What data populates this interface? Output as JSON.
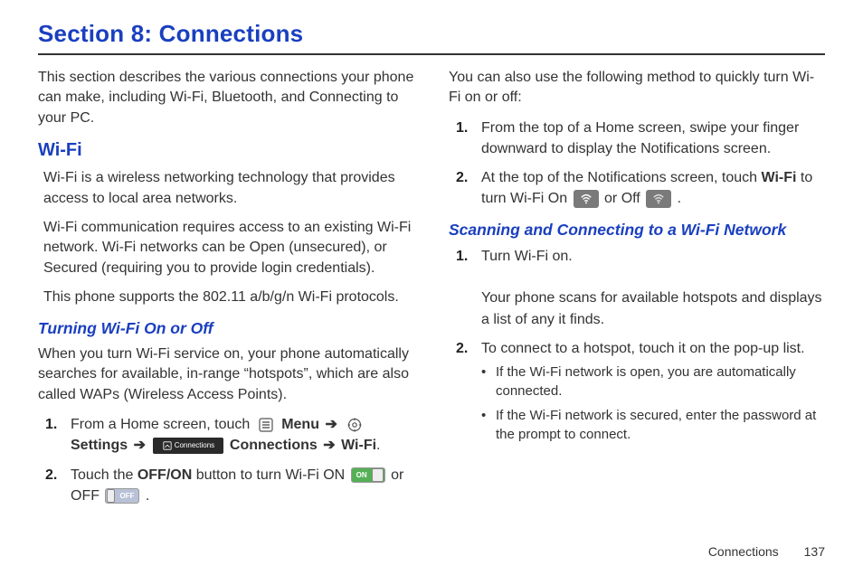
{
  "section_title": "Section 8: Connections",
  "footer": {
    "chapter": "Connections",
    "page": "137"
  },
  "left": {
    "intro": "This section describes the various connections your phone can make, including Wi-Fi, Bluetooth, and Connecting to your PC.",
    "wifi_heading": "Wi-Fi",
    "wifi_p1": "Wi-Fi is a wireless networking technology that provides access to local area networks.",
    "wifi_p2": "Wi-Fi communication requires access to an existing Wi-Fi network. Wi-Fi networks can be Open (unsecured), or Secured (requiring you to provide login credentials).",
    "wifi_p3": "This phone supports the 802.11 a/b/g/n Wi-Fi protocols.",
    "turning_heading": "Turning Wi-Fi On or Off",
    "turning_intro": "When you turn Wi-Fi service on, your phone automatically searches for available, in-range “hotspots”, which are also called WAPs (Wireless Access Points).",
    "step1": {
      "pre": "From a Home screen, touch ",
      "menu": "Menu",
      "settings": "Settings",
      "connections": "Connections",
      "wifi": "Wi-Fi",
      "arrow": "➔"
    },
    "step2": {
      "pre": "Touch the ",
      "offon": "OFF/ON",
      "mid": " button to turn Wi-Fi ON ",
      "or": " or OFF ",
      "end": "."
    },
    "toggle_on": "ON",
    "toggle_off": "OFF",
    "conn_icon_label": "Connections"
  },
  "right": {
    "quick_intro": "You can also use the following method to quickly turn Wi-Fi on or off:",
    "q_step1": "From the top of a Home screen, swipe your finger downward to display the Notifications screen.",
    "q_step2": {
      "pre": "At the top of the Notifications screen, touch ",
      "wifi": "Wi-Fi",
      "mid": " to turn Wi-Fi On ",
      "or": " or Off ",
      "end": "."
    },
    "scan_heading": "Scanning and Connecting to a Wi-Fi Network",
    "s_step1a": "Turn Wi-Fi on.",
    "s_step1b": "Your phone scans for available hotspots and displays a list of any it finds.",
    "s_step2": "To connect to a hotspot, touch it on the pop-up list.",
    "bullet1": "If the Wi-Fi network is open, you are automatically connected.",
    "bullet2": "If the Wi-Fi network is secured, enter the password at the prompt to connect."
  }
}
